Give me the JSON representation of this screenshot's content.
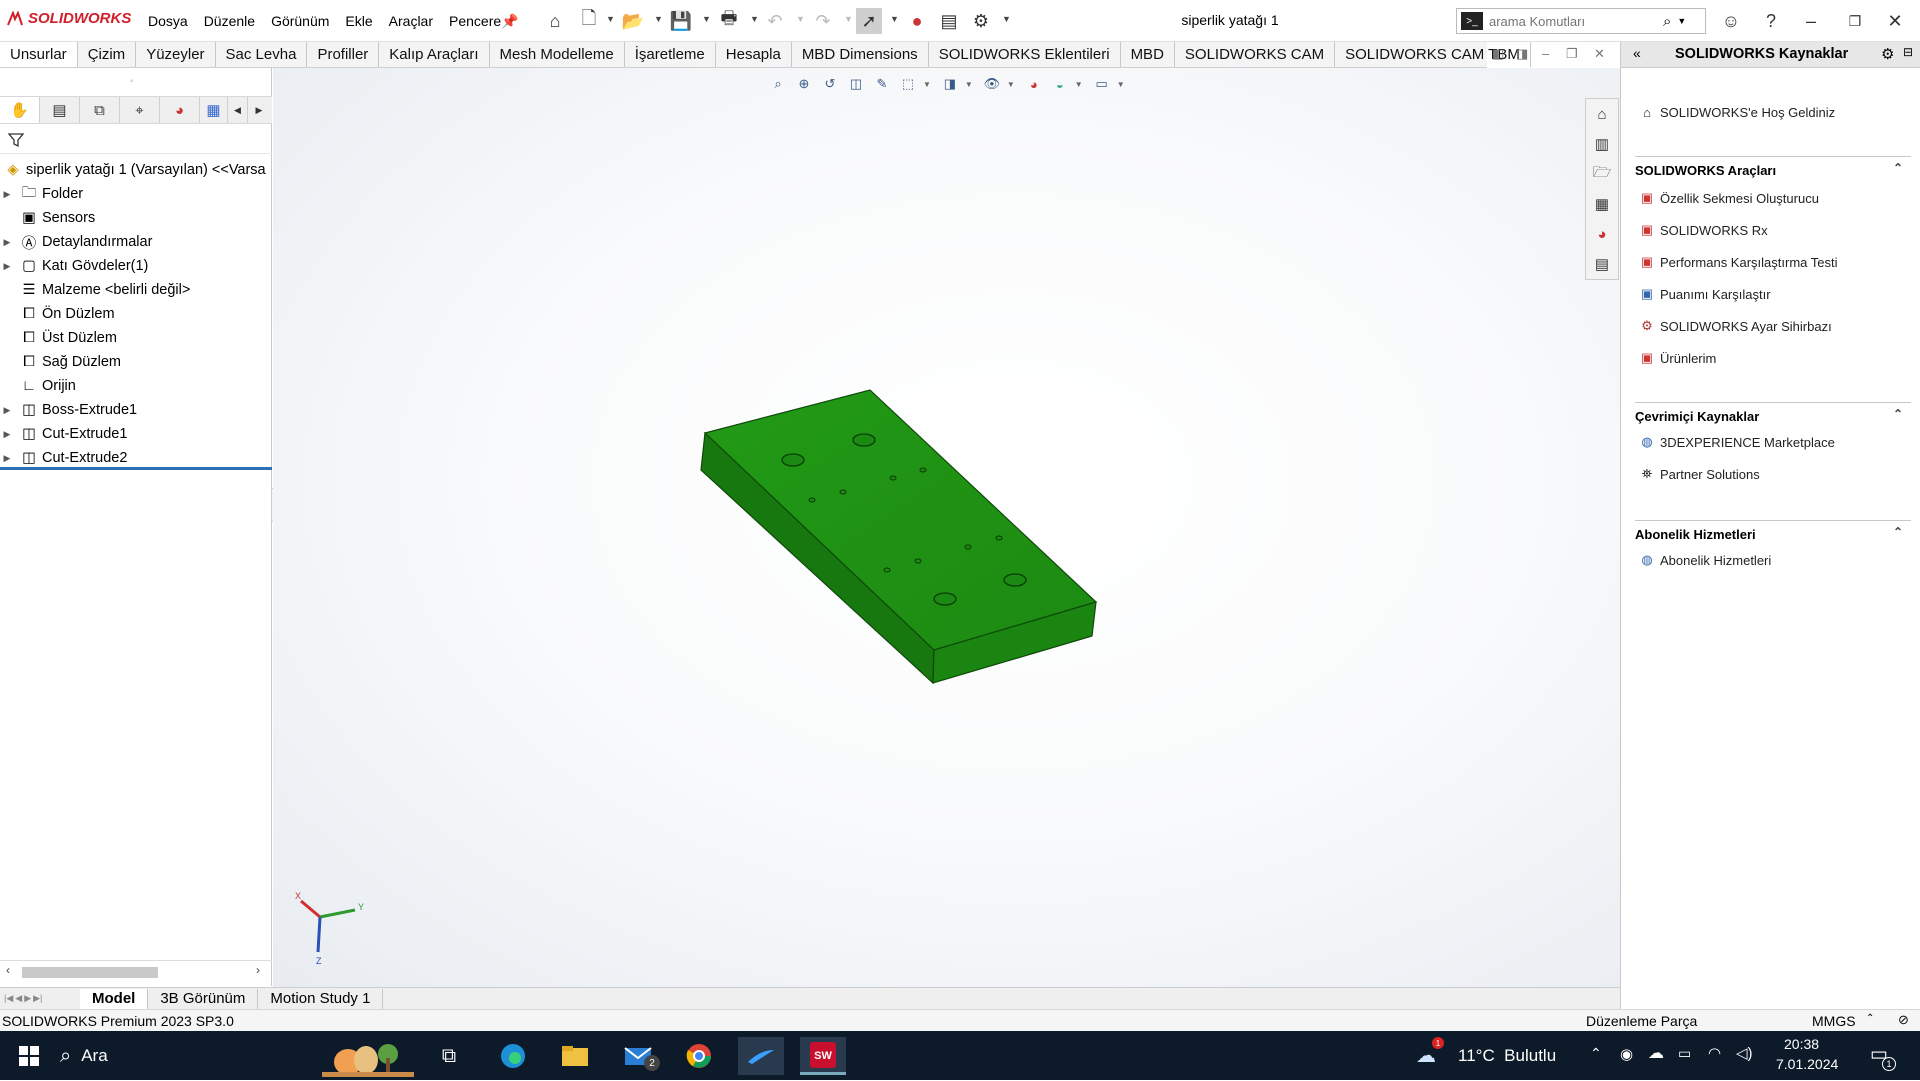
{
  "app": {
    "logo_text": "SOLIDWORKS",
    "menus": [
      "Dosya",
      "Düzenle",
      "Görünüm",
      "Ekle",
      "Araçlar",
      "Pencere"
    ],
    "document_title": "siperlik yatağı 1",
    "search_placeholder": "arama Komutları",
    "accent_color": "#d0202a"
  },
  "command_tabs": [
    "Unsurlar",
    "Çizim",
    "Yüzeyler",
    "Sac Levha",
    "Profiller",
    "Kalıp Araçları",
    "Mesh Modelleme",
    "İşaretleme",
    "Hesapla",
    "MBD Dimensions",
    "SOLIDWORKS Eklentileri",
    "MBD",
    "SOLIDWORKS CAM",
    "SOLIDWORKS CAM TBM"
  ],
  "feature_tree": {
    "root": "siperlik yatağı 1 (Varsayılan) <<Varsa",
    "items": [
      {
        "label": "Folder",
        "expandable": true,
        "icon": "folder-icon"
      },
      {
        "label": "Sensors",
        "expandable": false,
        "icon": "sensors-icon"
      },
      {
        "label": "Detaylandırmalar",
        "expandable": true,
        "icon": "annotations-icon"
      },
      {
        "label": "Katı Gövdeler(1)",
        "expandable": true,
        "icon": "solid-bodies-icon"
      },
      {
        "label": "Malzeme <belirli değil>",
        "expandable": false,
        "icon": "material-icon"
      },
      {
        "label": "Ön Düzlem",
        "expandable": false,
        "icon": "plane-icon"
      },
      {
        "label": "Üst Düzlem",
        "expandable": false,
        "icon": "plane-icon"
      },
      {
        "label": "Sağ Düzlem",
        "expandable": false,
        "icon": "plane-icon"
      },
      {
        "label": "Orijin",
        "expandable": false,
        "icon": "origin-icon"
      },
      {
        "label": "Boss-Extrude1",
        "expandable": true,
        "icon": "extrude-icon"
      },
      {
        "label": "Cut-Extrude1",
        "expandable": true,
        "icon": "cut-extrude-icon"
      },
      {
        "label": "Cut-Extrude2",
        "expandable": true,
        "icon": "cut-extrude-icon"
      }
    ]
  },
  "bottom_tabs": [
    "Model",
    "3B Görünüm",
    "Motion Study 1"
  ],
  "status": {
    "left": "SOLIDWORKS Premium 2023 SP3.0",
    "mode": "Düzenleme Parça",
    "units": "MMGS"
  },
  "triad": {
    "x": "X",
    "y": "Y",
    "z": "Z"
  },
  "model_color": "#1f8a14",
  "resources": {
    "title": "SOLIDWORKS Kaynaklar",
    "welcome": "SOLIDWORKS'e Hoş Geldiniz",
    "tools_header": "SOLIDWORKS Araçları",
    "tools": [
      "Özellik Sekmesi Oluşturucu",
      "SOLIDWORKS Rx",
      "Performans Karşılaştırma Testi",
      "Puanımı Karşılaştır",
      "SOLIDWORKS Ayar Sihirbazı",
      "Ürünlerim"
    ],
    "online_header": "Çevrimiçi Kaynaklar",
    "online": [
      "3DEXPERIENCE Marketplace",
      "Partner Solutions"
    ],
    "subscription_header": "Abonelik Hizmetleri",
    "subscription": [
      "Abonelik Hizmetleri"
    ]
  },
  "taskbar": {
    "search_label": "Ara",
    "weather": "11°C  Bulutlu",
    "weather_badge": "1",
    "time": "20:38",
    "date": "7.01.2024",
    "mail_badge": "2",
    "notification_count": "1"
  }
}
